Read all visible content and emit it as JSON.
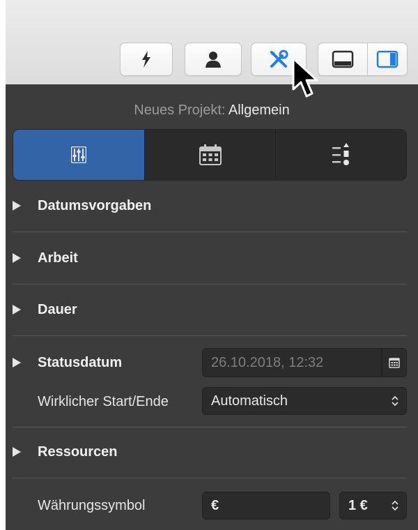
{
  "toolbar": {
    "buttons": [
      {
        "name": "lightning-icon"
      },
      {
        "name": "person-icon"
      },
      {
        "name": "tools-icon"
      },
      {
        "name": "bottom-panel-icon"
      },
      {
        "name": "side-panel-icon"
      }
    ]
  },
  "panel": {
    "title_prefix": "Neues Projekt:",
    "title_value": "Allgemein",
    "tabs": [
      "sliders-icon",
      "calendar-icon",
      "list-icon"
    ],
    "sections": {
      "datumsvorgaben": "Datumsvorgaben",
      "arbeit": "Arbeit",
      "dauer": "Dauer",
      "statusdatum": "Statusdatum",
      "ressourcen": "Ressourcen"
    },
    "status_date_value": "26.10.2018, 12:32",
    "actual_start_label": "Wirklicher Start/Ende",
    "actual_start_value": "Automatisch",
    "currency_label": "Währungssymbol",
    "currency_value": "€",
    "currency_format_value": "1 €"
  },
  "colors": {
    "accent": "#3464a8",
    "panel": "#3c3c3c"
  }
}
